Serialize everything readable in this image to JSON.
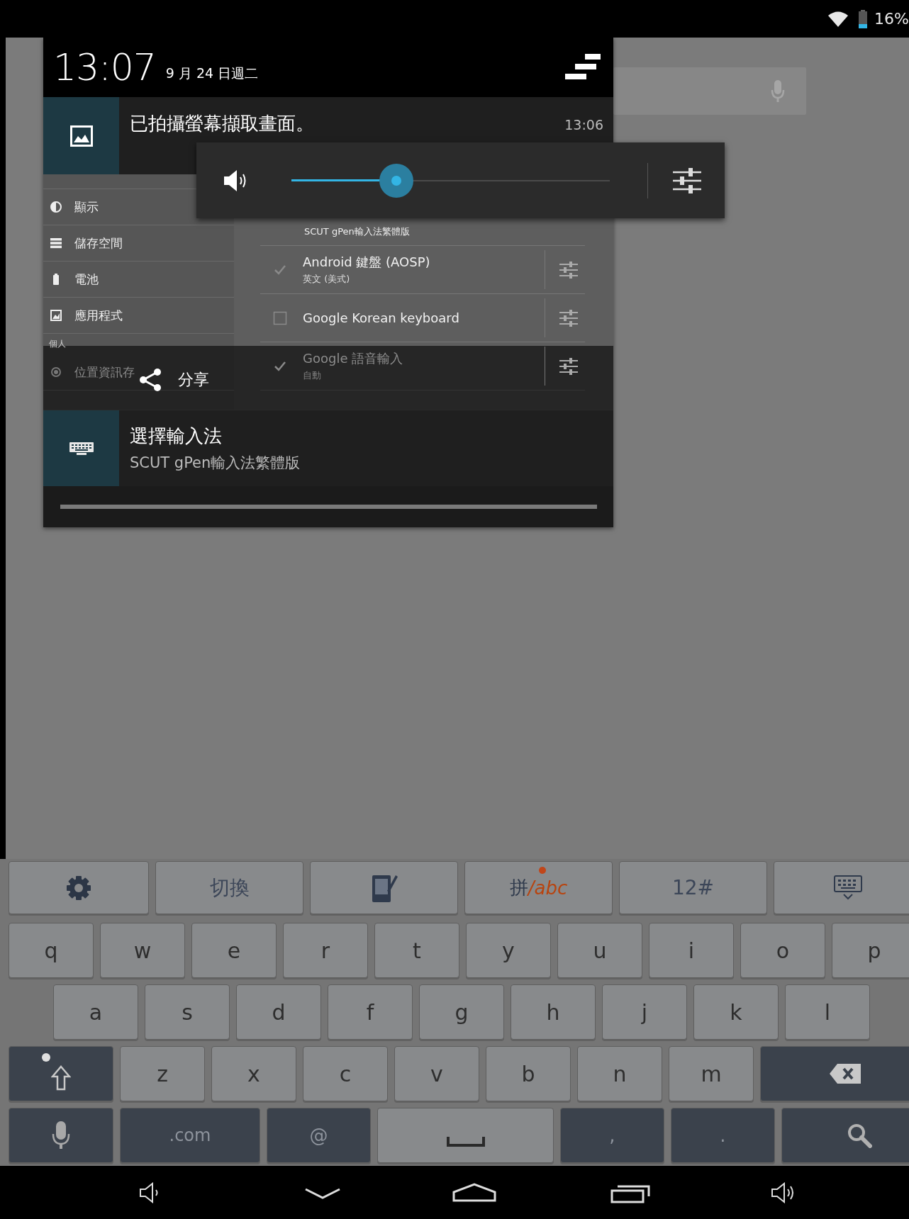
{
  "status_bar": {
    "battery": "16%"
  },
  "notification_shade": {
    "time": "13:07",
    "date": "9 月 24 日週二",
    "notifications": [
      {
        "kind": "screenshot",
        "title": "已拍攝螢幕擷取畫面。",
        "time": "13:06",
        "action": "分享",
        "preview": {
          "settings_menu": [
            {
              "kind": "display",
              "label": "顯示"
            },
            {
              "kind": "storage",
              "label": "儲存空間"
            },
            {
              "kind": "battery",
              "label": "電池"
            },
            {
              "kind": "apps",
              "label": "應用程式"
            },
            {
              "kind": "header",
              "label": "個人"
            },
            {
              "kind": "location",
              "label": "位置資訊存"
            }
          ],
          "input_methods_caption": "SCUT gPen輸入法繁體版",
          "input_methods": [
            {
              "name": "Android 鍵盤 (AOSP)",
              "subtitle": "英文 (美式)",
              "checked": true
            },
            {
              "name": "Google Korean keyboard",
              "checked": false
            },
            {
              "name": "Google 語音輸入",
              "subtitle": "自動",
              "checked": true
            }
          ]
        }
      },
      {
        "kind": "input_method",
        "title": "選擇輸入法",
        "text": "SCUT gPen輸入法繁體版"
      }
    ]
  },
  "volume": {
    "level": 0.33
  },
  "keyboard": {
    "rows": [
      [
        {
          "kind": "settings"
        },
        {
          "kind": "function",
          "label": "切換"
        },
        {
          "kind": "handwriting"
        },
        {
          "kind": "mode",
          "label": "拼",
          "alt": "/abc"
        },
        {
          "kind": "function",
          "label": "12#"
        },
        {
          "kind": "hide"
        }
      ],
      [
        {
          "kind": "letter",
          "label": "q"
        },
        {
          "kind": "letter",
          "label": "w"
        },
        {
          "kind": "letter",
          "label": "e"
        },
        {
          "kind": "letter",
          "label": "r"
        },
        {
          "kind": "letter",
          "label": "t"
        },
        {
          "kind": "letter",
          "label": "y"
        },
        {
          "kind": "letter",
          "label": "u"
        },
        {
          "kind": "letter",
          "label": "i"
        },
        {
          "kind": "letter",
          "label": "o"
        },
        {
          "kind": "letter",
          "label": "p"
        }
      ],
      [
        {
          "kind": "letter",
          "label": "a"
        },
        {
          "kind": "letter",
          "label": "s"
        },
        {
          "kind": "letter",
          "label": "d"
        },
        {
          "kind": "letter",
          "label": "f"
        },
        {
          "kind": "letter",
          "label": "g"
        },
        {
          "kind": "letter",
          "label": "h"
        },
        {
          "kind": "letter",
          "label": "j"
        },
        {
          "kind": "letter",
          "label": "k"
        },
        {
          "kind": "letter",
          "label": "l"
        }
      ],
      [
        {
          "kind": "shift"
        },
        {
          "kind": "letter",
          "label": "z"
        },
        {
          "kind": "letter",
          "label": "x"
        },
        {
          "kind": "letter",
          "label": "c"
        },
        {
          "kind": "letter",
          "label": "v"
        },
        {
          "kind": "letter",
          "label": "b"
        },
        {
          "kind": "letter",
          "label": "n"
        },
        {
          "kind": "letter",
          "label": "m"
        },
        {
          "kind": "backspace"
        }
      ],
      [
        {
          "kind": "mic"
        },
        {
          "kind": "dark_wide",
          "label": ".com"
        },
        {
          "kind": "dark",
          "label": "@"
        },
        {
          "kind": "space"
        },
        {
          "kind": "dark",
          "label": ","
        },
        {
          "kind": "dark",
          "label": "."
        },
        {
          "kind": "search"
        }
      ]
    ]
  }
}
